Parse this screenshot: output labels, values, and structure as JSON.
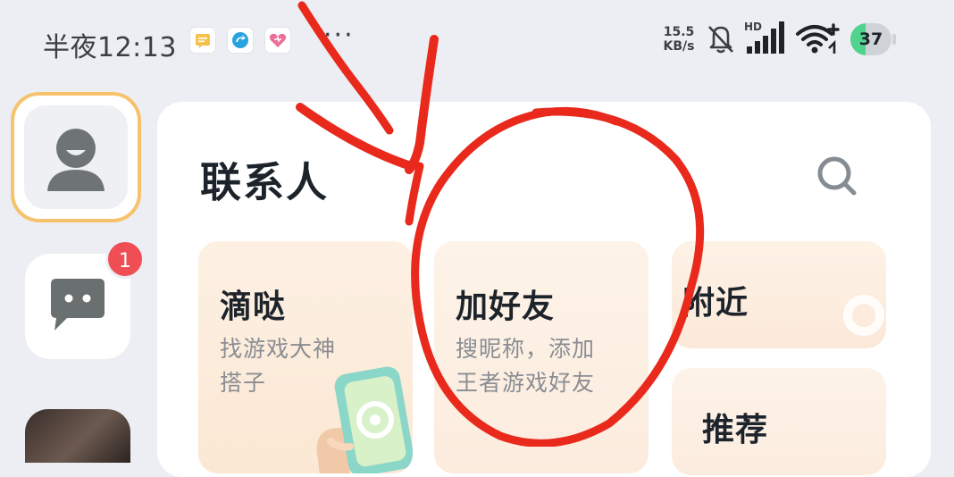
{
  "status_bar": {
    "time": "半夜12:13",
    "net_speed_value": "15.5",
    "net_speed_unit": "KB/s",
    "hd_label": "HD",
    "battery_level": "37",
    "battery_fraction": 0.37,
    "icons": [
      "note-app-icon",
      "arrow-app-icon",
      "heart-app-icon",
      "more-dots-icon",
      "mute-bell-icon",
      "signal-icon",
      "wifi-icon",
      "battery-icon"
    ],
    "more": "···"
  },
  "sidebar": {
    "message_badge": "1",
    "items": [
      "avatar",
      "messages",
      "photo"
    ]
  },
  "panel": {
    "title": "联系人",
    "cards": [
      {
        "title": "滴哒",
        "subtitle_lines": [
          "找游戏大神",
          "搭子"
        ]
      },
      {
        "title": "加好友",
        "subtitle_lines": [
          "搜昵称，添加",
          "王者游戏好友"
        ]
      },
      {
        "title": "附近"
      },
      {
        "title": "推荐"
      }
    ]
  },
  "colors": {
    "background": "#eceef3",
    "panel": "#ffffff",
    "avatar_border": "#f6c36c",
    "badge": "#ef4e55",
    "battery_fill": "#4fd38d",
    "annotation": "#e8291c",
    "card_tint": "#fcecde"
  }
}
